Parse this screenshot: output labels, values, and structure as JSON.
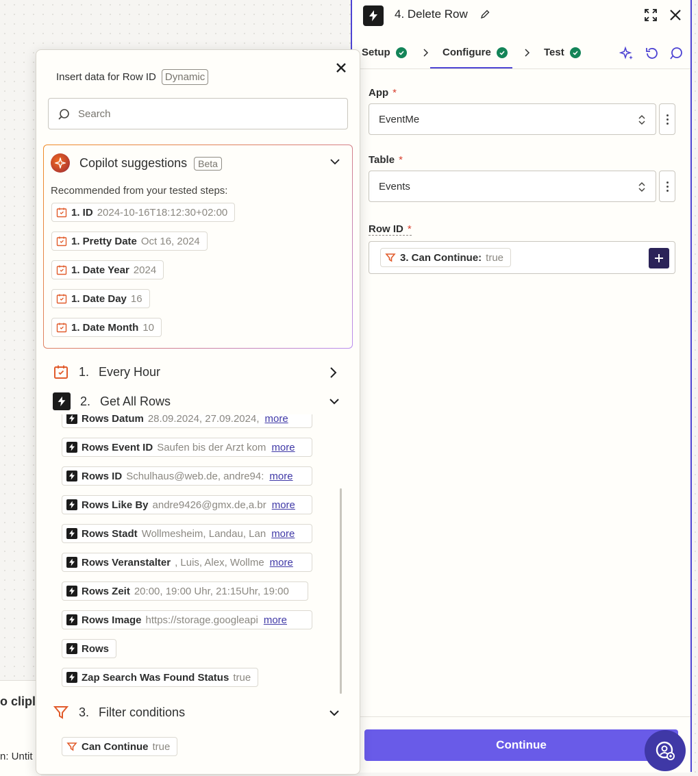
{
  "editor": {
    "step_title": "4.  Delete Row",
    "tabs": [
      {
        "label": "Setup"
      },
      {
        "label": "Configure"
      },
      {
        "label": "Test"
      }
    ],
    "fields": {
      "app_label": "App",
      "app_value": "EventMe",
      "table_label": "Table",
      "table_value": "Events",
      "rowid_label": "Row ID",
      "rowid_token_label": "3. Can Continue:",
      "rowid_token_value": "true",
      "required_mark": "*"
    },
    "continue_label": "Continue"
  },
  "behind": {
    "text1": "o clipl",
    "text2": "n: Untit"
  },
  "popover": {
    "title": "Insert data for Row ID",
    "badge": "Dynamic",
    "search_placeholder": "Search",
    "copilot": {
      "title": "Copilot suggestions",
      "badge": "Beta",
      "subtitle": "Recommended from your tested steps:",
      "items": [
        {
          "label": "1. ID",
          "value": "2024-10-16T18:12:30+02:00"
        },
        {
          "label": "1. Pretty Date",
          "value": "Oct 16, 2024"
        },
        {
          "label": "1. Date Year",
          "value": "2024"
        },
        {
          "label": "1. Date Day",
          "value": "16"
        },
        {
          "label": "1. Date Month",
          "value": "10"
        }
      ]
    },
    "sections": [
      {
        "num": "1.",
        "title": "Every Hour"
      },
      {
        "num": "2.",
        "title": "Get All Rows"
      },
      {
        "num": "3.",
        "title": "Filter conditions"
      }
    ],
    "rows": [
      {
        "label": "Rows Datum",
        "value": "28.09.2024, 27.09.2024,",
        "more": "more"
      },
      {
        "label": "Rows Event ID",
        "value": "Saufen bis der Arzt kom",
        "more": "more"
      },
      {
        "label": "Rows ID",
        "value": "Schulhaus@web.de, andre94:",
        "more": "more"
      },
      {
        "label": "Rows Like By",
        "value": "andre9426@gmx.de,a.br",
        "more": "more"
      },
      {
        "label": "Rows Stadt",
        "value": "Wollmesheim, Landau, Lan",
        "more": "more"
      },
      {
        "label": "Rows Veranstalter",
        "value": ", Luis, Alex, Wollme",
        "more": "more"
      },
      {
        "label": "Rows Zeit",
        "value": "20:00, 19:00 Uhr, 21:15Uhr, 19:00",
        "more": ""
      },
      {
        "label": "Rows Image",
        "value": "https://storage.googleapi",
        "more": "more"
      },
      {
        "label": "Rows",
        "value": "",
        "more": ""
      },
      {
        "label": "Zap Search Was Found Status",
        "value": "true",
        "more": ""
      }
    ],
    "filter_item": {
      "label": "Can Continue",
      "value": "true"
    }
  }
}
